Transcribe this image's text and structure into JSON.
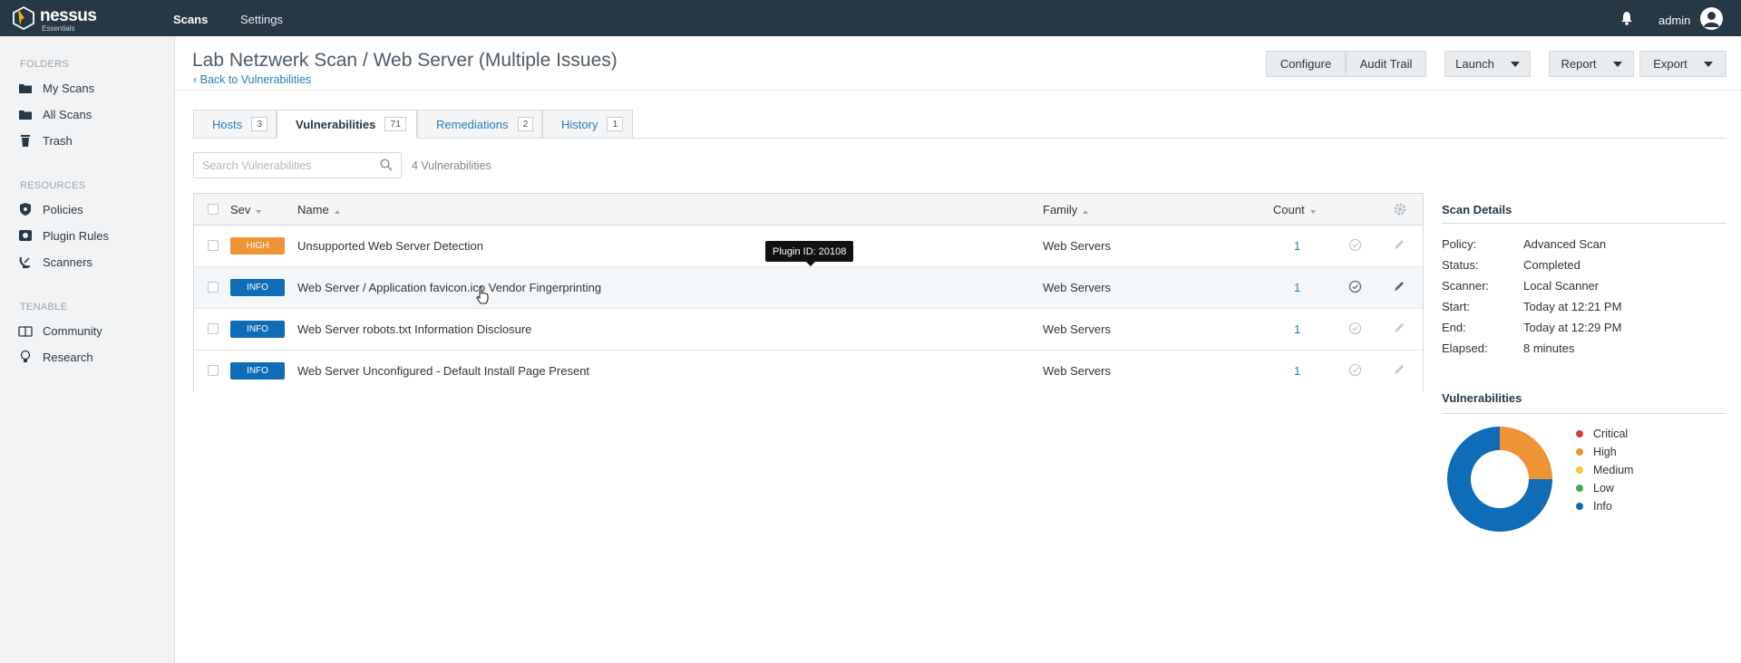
{
  "brand": {
    "name": "nessus",
    "edition": "Essentials"
  },
  "topnav": {
    "scans": "Scans",
    "settings": "Settings"
  },
  "user": {
    "name": "admin"
  },
  "sidebar": {
    "folders_heading": "FOLDERS",
    "folders": [
      {
        "label": "My Scans",
        "icon": "folder-icon"
      },
      {
        "label": "All Scans",
        "icon": "folder-icon"
      },
      {
        "label": "Trash",
        "icon": "trash-icon"
      }
    ],
    "resources_heading": "RESOURCES",
    "resources": [
      {
        "label": "Policies",
        "icon": "shield-icon"
      },
      {
        "label": "Plugin Rules",
        "icon": "plugin-icon"
      },
      {
        "label": "Scanners",
        "icon": "satellite-icon"
      }
    ],
    "tenable_heading": "TENABLE",
    "tenable": [
      {
        "label": "Community",
        "icon": "community-icon"
      },
      {
        "label": "Research",
        "icon": "lightbulb-icon"
      }
    ]
  },
  "header": {
    "title": "Lab Netzwerk Scan / Web Server (Multiple Issues)",
    "back_link": "Back to Vulnerabilities",
    "buttons": {
      "configure": "Configure",
      "audit_trail": "Audit Trail",
      "launch": "Launch",
      "report": "Report",
      "export": "Export"
    }
  },
  "tabs": [
    {
      "label": "Hosts",
      "count": "3"
    },
    {
      "label": "Vulnerabilities",
      "count": "71"
    },
    {
      "label": "Remediations",
      "count": "2"
    },
    {
      "label": "History",
      "count": "1"
    }
  ],
  "search": {
    "placeholder": "Search Vulnerabilities",
    "result_count": "4 Vulnerabilities"
  },
  "table": {
    "columns": {
      "sev": "Sev",
      "name": "Name",
      "family": "Family",
      "count": "Count"
    },
    "rows": [
      {
        "sev": "HIGH",
        "sev_color": "#ee9336",
        "name": "Unsupported Web Server Detection",
        "family": "Web Servers",
        "count": "1"
      },
      {
        "sev": "INFO",
        "sev_color": "#0f6cb6",
        "name": "Web Server / Application favicon.ico Vendor Fingerprinting",
        "family": "Web Servers",
        "count": "1"
      },
      {
        "sev": "INFO",
        "sev_color": "#0f6cb6",
        "name": "Web Server robots.txt Information Disclosure",
        "family": "Web Servers",
        "count": "1"
      },
      {
        "sev": "INFO",
        "sev_color": "#0f6cb6",
        "name": "Web Server Unconfigured - Default Install Page Present",
        "family": "Web Servers",
        "count": "1"
      }
    ]
  },
  "tooltip": "Plugin ID: 20108",
  "scan_details": {
    "title": "Scan Details",
    "items": [
      {
        "label": "Policy:",
        "value": "Advanced Scan"
      },
      {
        "label": "Status:",
        "value": "Completed"
      },
      {
        "label": "Scanner:",
        "value": "Local Scanner"
      },
      {
        "label": "Start:",
        "value": "Today at 12:21 PM"
      },
      {
        "label": "End:",
        "value": "Today at 12:29 PM"
      },
      {
        "label": "Elapsed:",
        "value": "8 minutes"
      }
    ]
  },
  "vulnerabilities_panel": {
    "title": "Vulnerabilities",
    "legend": [
      {
        "label": "Critical",
        "color": "#d43f3a"
      },
      {
        "label": "High",
        "color": "#ee9336"
      },
      {
        "label": "Medium",
        "color": "#fdc431"
      },
      {
        "label": "Low",
        "color": "#3fae49"
      },
      {
        "label": "Info",
        "color": "#0f6cb6"
      }
    ],
    "donut_share": {
      "high": 0.25,
      "info": 0.75
    }
  }
}
